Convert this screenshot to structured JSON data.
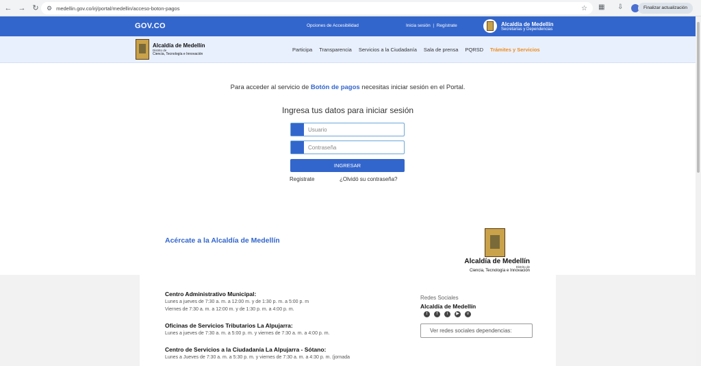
{
  "browser": {
    "url": "medellin.gov.co/irj/portal/medellin/acceso-boton-pagos",
    "update_label": "Finalizar actualización"
  },
  "gov": {
    "logo": "GOV.CO",
    "accessibility": "Opciones de Accesibilidad",
    "login": "Inicia sesión",
    "sep": "|",
    "register": "Regístrate",
    "org": "Alcaldía de Medellín",
    "org_sub": "Secretarías y Dependencias"
  },
  "logo": {
    "name": "Alcaldía de Medellín",
    "line2": "Distrito de",
    "line3": "Ciencia, Tecnología e Innovación"
  },
  "menu": [
    "Participa",
    "Transparencia",
    "Servicios a la Ciudadanía",
    "Sala de prensa",
    "PQRSD",
    "Trámites y Servicios"
  ],
  "intro": {
    "before": "Para acceder al servicio de ",
    "link": "Botón de pagos",
    "after": " necesitas iniciar sesión en el Portal."
  },
  "form": {
    "title": "Ingresa tus datos para iniciar sesión",
    "user_placeholder": "Usuario",
    "pass_placeholder": "Contraseña",
    "submit": "INGRESAR",
    "register": "Registrate",
    "forgot": "¿Olvidó su contraseña?"
  },
  "footer": {
    "approach": "Acércate a la Alcaldía de Medellín",
    "logo_name": "Alcaldía de Medellín",
    "logo_line2": "Distrito de",
    "logo_line3": "Ciencia, Tecnología e Innovación",
    "h1": "Centro Administrativo Municipal:",
    "h1_l1": "Lunes a jueves de 7:30 a. m. a 12:00 m. y de 1:30 p. m. a 5:00 p. m",
    "h1_l2": "Viernes de 7:30 a. m. a 12:00 m. y de 1:30 p. m. a 4:00 p. m.",
    "h2": "Oficinas de Servicios Tributarios La Alpujarra:",
    "h2_l1": "Lunes a jueves de 7:30 a. m. a 5:00 p. m. y viernes de 7:30 a. m. a 4:00 p. m.",
    "h3": "Centro de Servicios a la Ciudadanía La Alpujarra - Sótano:",
    "h3_l1": "Lunes a Jueves de 7:30 a. m. a 5:30 p. m. y viernes de 7:30 a. m. a 4:30 p. m. (jornada",
    "social_title": "Redes Sociales",
    "social_org": "Alcaldía de Medellín",
    "social_dropdown": "Ver redes sociales dependencias:"
  }
}
